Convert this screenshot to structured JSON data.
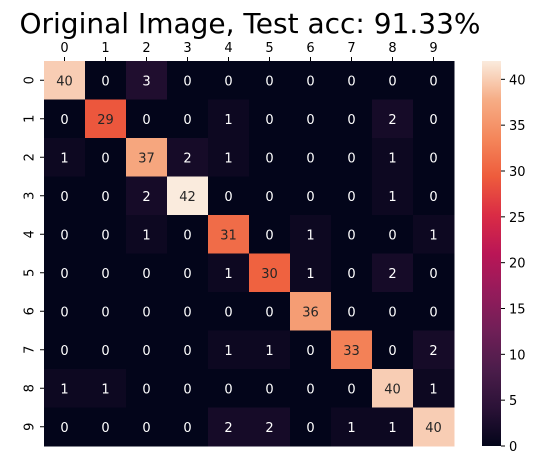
{
  "chart_data": {
    "type": "heatmap",
    "title": "Original Image, Test acc: 91.33%",
    "x_tick_labels": [
      "0",
      "1",
      "2",
      "3",
      "4",
      "5",
      "6",
      "7",
      "8",
      "9"
    ],
    "y_tick_labels": [
      "0",
      "1",
      "2",
      "3",
      "4",
      "5",
      "6",
      "7",
      "8",
      "9"
    ],
    "x_ticks_position": "top",
    "y_tick_rotation": "vertical",
    "values": [
      [
        40,
        0,
        3,
        0,
        0,
        0,
        0,
        0,
        0,
        0
      ],
      [
        0,
        29,
        0,
        0,
        1,
        0,
        0,
        0,
        2,
        0
      ],
      [
        1,
        0,
        37,
        2,
        1,
        0,
        0,
        0,
        1,
        0
      ],
      [
        0,
        0,
        2,
        42,
        0,
        0,
        0,
        0,
        1,
        0
      ],
      [
        0,
        0,
        1,
        0,
        31,
        0,
        1,
        0,
        0,
        1
      ],
      [
        0,
        0,
        0,
        0,
        1,
        30,
        1,
        0,
        2,
        0
      ],
      [
        0,
        0,
        0,
        0,
        0,
        0,
        36,
        0,
        0,
        0
      ],
      [
        0,
        0,
        0,
        0,
        1,
        1,
        0,
        33,
        0,
        2
      ],
      [
        1,
        1,
        0,
        0,
        0,
        0,
        0,
        0,
        40,
        1
      ],
      [
        0,
        0,
        0,
        0,
        2,
        2,
        0,
        1,
        1,
        40
      ]
    ],
    "colorbar": {
      "min": 0,
      "max": 42,
      "ticks": [
        0,
        5,
        10,
        15,
        20,
        25,
        30,
        35,
        40
      ],
      "colormap": "rocket",
      "stops": [
        "#03051a",
        "#2b1237",
        "#4c1d4b",
        "#701f57",
        "#951b5b",
        "#ba1656",
        "#da2c45",
        "#ee5c3c",
        "#f4875b",
        "#f6ad86",
        "#faebdd"
      ]
    },
    "annotations": true,
    "grid": false,
    "legend": "colorbar-right"
  }
}
